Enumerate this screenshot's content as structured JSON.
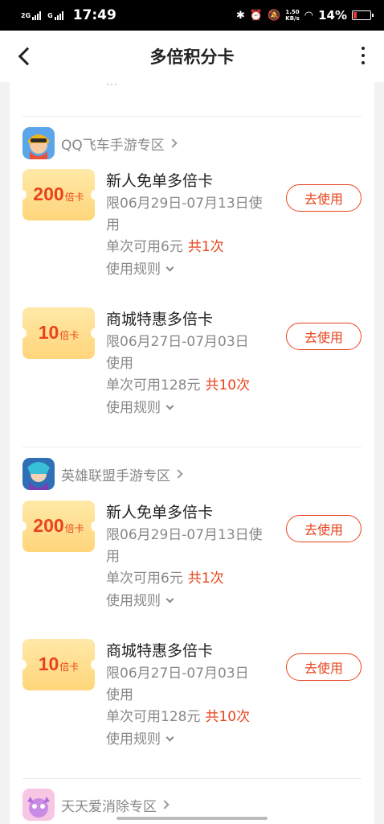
{
  "status": {
    "sig1": "2G",
    "sig2": "G",
    "time": "17:49",
    "net_top": "1.50",
    "net_bottom": "KB/s",
    "battery": "14%"
  },
  "header": {
    "title": "多倍积分卡"
  },
  "top_hint": "…",
  "zones": [
    {
      "name": "QQ飞车手游专区",
      "coupons": [
        {
          "num": "200",
          "unit": "倍卡",
          "title": "新人免单多倍卡",
          "date1": "限06月29日-07月13日使",
          "date2": "用",
          "limit": "单次可用6元",
          "count": "共1次",
          "rule": "使用规则",
          "btn": "去使用"
        },
        {
          "num": "10",
          "unit": "倍卡",
          "title": "商城特惠多倍卡",
          "date1": "限06月27日-07月03日",
          "date2": "使用",
          "limit": "单次可用128元",
          "count": "共10次",
          "rule": "使用规则",
          "btn": "去使用"
        }
      ]
    },
    {
      "name": "英雄联盟手游专区",
      "coupons": [
        {
          "num": "200",
          "unit": "倍卡",
          "title": "新人免单多倍卡",
          "date1": "限06月29日-07月13日使",
          "date2": "用",
          "limit": "单次可用6元",
          "count": "共1次",
          "rule": "使用规则",
          "btn": "去使用"
        },
        {
          "num": "10",
          "unit": "倍卡",
          "title": "商城特惠多倍卡",
          "date1": "限06月27日-07月03日",
          "date2": "使用",
          "limit": "单次可用128元",
          "count": "共10次",
          "rule": "使用规则",
          "btn": "去使用"
        }
      ]
    },
    {
      "name": "天天爱消除专区",
      "coupons": []
    }
  ],
  "colors": {
    "accent": "#e8431d",
    "ticket": "#ffd57a"
  }
}
